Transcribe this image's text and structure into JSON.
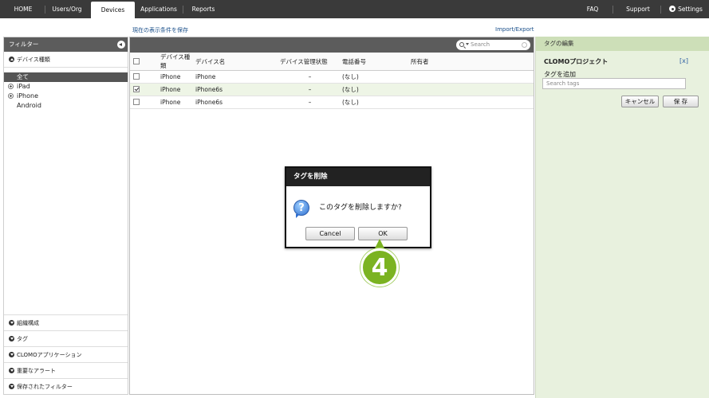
{
  "nav": {
    "tabs": [
      "HOME",
      "Users/Org",
      "Devices",
      "Applications",
      "Reports"
    ],
    "active_tab": "Devices",
    "right_links": [
      "FAQ",
      "Support",
      "Settings"
    ]
  },
  "subbar": {
    "save_view": "現在の表示条件を保存",
    "import_export": "Import/Export"
  },
  "filter": {
    "title": "フィルター",
    "section_device_type": "デバイス種類",
    "all_label": "全て",
    "items": [
      "iPad",
      "iPhone",
      "Android"
    ],
    "bottom_sections": [
      "組織構成",
      "タグ",
      "CLOMOアプリケーション",
      "重要なアラート",
      "保存されたフィルター"
    ]
  },
  "search": {
    "placeholder": "Search"
  },
  "table": {
    "headers": [
      "デバイス種類",
      "デバイス名",
      "デバイス管理状態",
      "電話番号",
      "所有者"
    ],
    "rows": [
      {
        "type": "iPhone",
        "name": "iPhone",
        "status": "–",
        "phone": "(なし)",
        "owner": "",
        "checked": false
      },
      {
        "type": "iPhone",
        "name": "iPhone6s",
        "status": "–",
        "phone": "(なし)",
        "owner": "",
        "checked": true
      },
      {
        "type": "iPhone",
        "name": "iPhone6s",
        "status": "–",
        "phone": "(なし)",
        "owner": "",
        "checked": false
      }
    ]
  },
  "tag_panel": {
    "title": "タグの編集",
    "project": "CLOMOプロジェクト",
    "remove": "[x]",
    "add_label": "タグを追加",
    "input_placeholder": "Search tags",
    "cancel": "キャンセル",
    "save": "保 存"
  },
  "dialog": {
    "title": "タグを削除",
    "message": "このタグを削除しますか?",
    "cancel": "Cancel",
    "ok": "OK",
    "icon": "question-icon"
  },
  "step_badge": "4",
  "colors": {
    "nav_bg": "#3a3a3a",
    "panel_green": "#e8f1de",
    "badge_green": "#7bb321"
  }
}
